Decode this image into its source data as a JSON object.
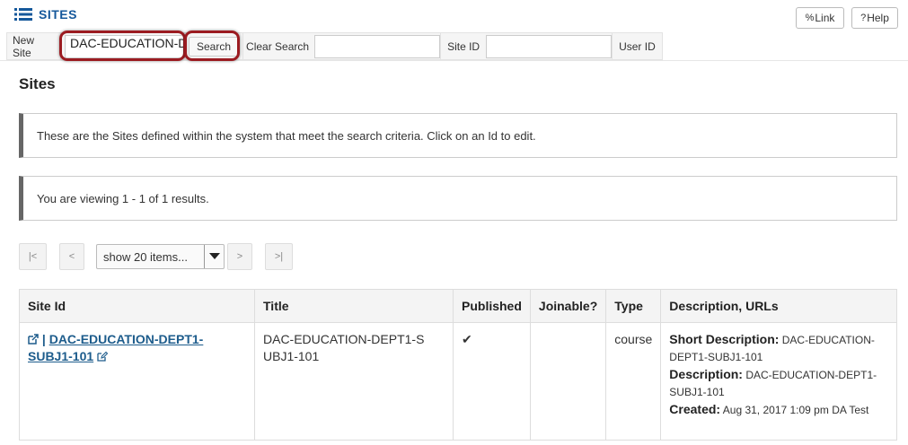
{
  "tool": {
    "title": "SITES",
    "icon": "list-icon"
  },
  "header_buttons": {
    "link_label": "Link",
    "link_icon": "link-icon",
    "help_label": "Help",
    "help_icon": "question-icon"
  },
  "nav": {
    "new_site": "New Site",
    "search_value": "DAC-EDUCATION-D",
    "search_button": "Search",
    "clear_search": "Clear Search",
    "site_id_label": "Site ID",
    "user_id_label": "User ID"
  },
  "page": {
    "heading": "Sites"
  },
  "messages": {
    "instructions": "These are the Sites defined within the system that meet the search criteria. Click on an Id to edit.",
    "viewing": "You are viewing 1 - 1 of 1 results."
  },
  "pager": {
    "first": "|<",
    "prev": "<",
    "page_size": "show 20 items...",
    "next": ">",
    "last": ">|"
  },
  "table": {
    "headers": [
      "Site Id",
      "Title",
      "Published",
      "Joinable?",
      "Type",
      "Description, URLs"
    ],
    "rows": [
      {
        "site_id_line1": "DAC-EDUCATION-DEPT1-",
        "site_id_line2": "SUBJ1-101",
        "title": "DAC-EDUCATION-DEPT1-SUBJ1-101",
        "published": "✔",
        "joinable": "",
        "type": "course",
        "short_desc_label": "Short Description:",
        "short_desc": "DAC-EDUCATION-DEPT1-SUBJ1-101",
        "desc_label": "Description:",
        "desc": "DAC-EDUCATION-DEPT1-SUBJ1-101",
        "created_label": "Created:",
        "created": "Aug 31, 2017 1:09 pm DA Test"
      }
    ]
  },
  "colors": {
    "highlight": "#9b1b21",
    "link": "#1d5c8c",
    "title": "#15589b"
  }
}
